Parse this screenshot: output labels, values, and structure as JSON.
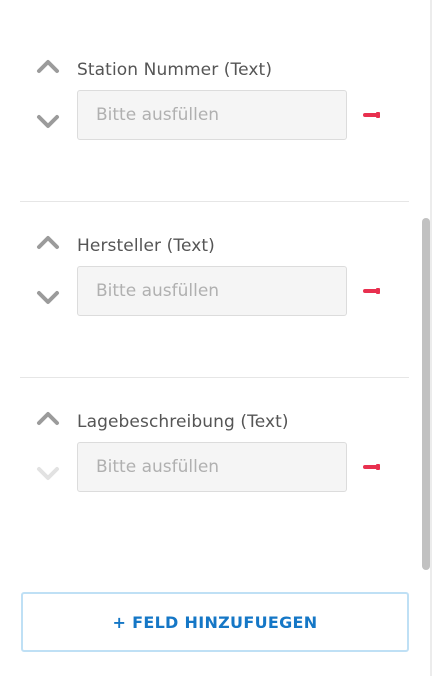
{
  "fields": [
    {
      "label": "Station Nummer (Text)",
      "placeholder": "Bitte ausfüllen",
      "value": "",
      "move_up_enabled": true,
      "move_down_enabled": true
    },
    {
      "label": "Hersteller (Text)",
      "placeholder": "Bitte ausfüllen",
      "value": "",
      "move_up_enabled": true,
      "move_down_enabled": true
    },
    {
      "label": "Lagebeschreibung (Text)",
      "placeholder": "Bitte ausfüllen",
      "value": "",
      "move_up_enabled": true,
      "move_down_enabled": false
    }
  ],
  "add_field_button": {
    "label": "+ FELD HINZUFUEGEN"
  },
  "icons": {
    "move_up": "chevron-up-icon",
    "move_down": "chevron-down-icon",
    "remove": "remove-field-icon"
  },
  "colors": {
    "accent": "#1577c6",
    "accent_border": "#bfe0f5",
    "remove": "#e8304f",
    "arrow_enabled": "#9b9b9b",
    "arrow_disabled": "#e2e2e2",
    "input_bg": "#f5f5f5"
  }
}
